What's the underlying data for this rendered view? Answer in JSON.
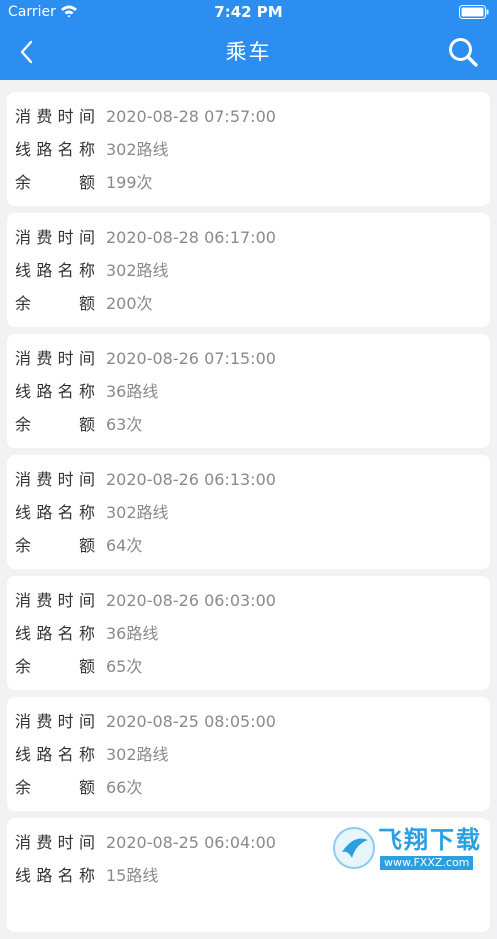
{
  "status_bar": {
    "carrier": "Carrier",
    "time": "7:42 PM"
  },
  "nav": {
    "title": "乘车",
    "back_icon": "chevron-left-icon",
    "search_icon": "search-icon"
  },
  "colors": {
    "header": "#2b8ef0",
    "background": "#f2f2f4",
    "label": "#333333",
    "value": "#8a8a8a"
  },
  "labels": {
    "time": "消费时间",
    "route": "线路名称",
    "balance": "余额"
  },
  "records": [
    {
      "time": "2020-08-28 07:57:00",
      "route": "302路线",
      "balance": "199次"
    },
    {
      "time": "2020-08-28 06:17:00",
      "route": "302路线",
      "balance": "200次"
    },
    {
      "time": "2020-08-26 07:15:00",
      "route": "36路线",
      "balance": "63次"
    },
    {
      "time": "2020-08-26 06:13:00",
      "route": "302路线",
      "balance": "64次"
    },
    {
      "time": "2020-08-26 06:03:00",
      "route": "36路线",
      "balance": "65次"
    },
    {
      "time": "2020-08-25 08:05:00",
      "route": "302路线",
      "balance": "66次"
    },
    {
      "time": "2020-08-25 06:04:00",
      "route": "15路线",
      "balance": ""
    }
  ],
  "watermark": {
    "text": "飞翔下载",
    "url": "www.FXXZ.com"
  }
}
